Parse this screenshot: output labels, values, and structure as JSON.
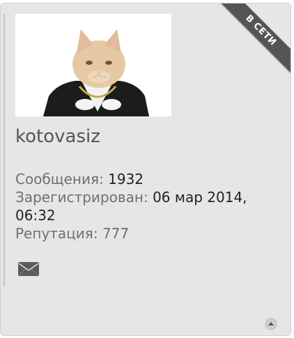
{
  "profile": {
    "username": "kotovasiz",
    "status_ribbon": "В СЕТИ",
    "posts_label": "Сообщения:",
    "posts_value": "1932",
    "registered_label": "Зарегистрирован:",
    "registered_value_line1": "06 мар 2014,",
    "registered_value_line2": "06:32",
    "reputation_label": "Репутация:",
    "reputation_value": "777"
  },
  "icons": {
    "avatar": "cat-in-suit-avatar",
    "message": "envelope-icon",
    "scroll_top": "up-arrow-circle-icon"
  },
  "colors": {
    "panel_bg": "#e6e6e6",
    "ribbon_bg": "#555555",
    "text_label": "#6f6f6f",
    "text_value": "#222222"
  }
}
